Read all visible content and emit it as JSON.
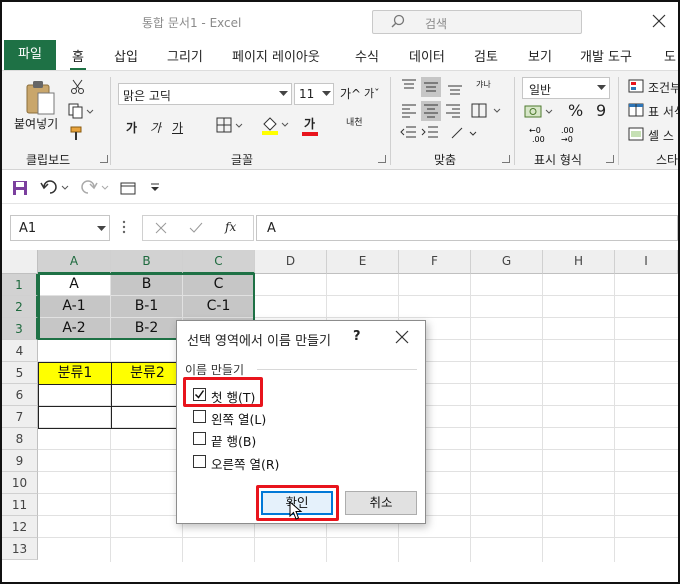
{
  "title_bar": {
    "doc_title": "통합 문서1  -  Excel",
    "search_placeholder": "검색"
  },
  "ribbon_tabs": [
    "파일",
    "홈",
    "삽입",
    "그리기",
    "페이지 레이아웃",
    "수식",
    "데이터",
    "검토",
    "보기",
    "개발 도구",
    "도"
  ],
  "ribbon": {
    "clipboard": {
      "paste_label": "붙여넣기",
      "group_label": "클립보드"
    },
    "font": {
      "font_name": "맑은 고딕",
      "font_size": "11",
      "grow": "가^",
      "shrink": "가ˇ",
      "bold": "가",
      "italic": "가",
      "underline": "가",
      "font_color_glyph": "가",
      "phonetic": "내천",
      "group_label": "글꼴"
    },
    "alignment": {
      "group_label": "맞춤",
      "wrap_glyph": "갸나"
    },
    "number": {
      "format": "일반",
      "percent": "%",
      "comma": "9",
      "group_label": "표시 형식"
    },
    "styles": {
      "conditional": "조건부",
      "table": "표 서식",
      "cell": "셀 스",
      "group_label": "스타"
    }
  },
  "formula_bar": {
    "name_box": "A1",
    "fx": "fx",
    "value": "A"
  },
  "columns": [
    "A",
    "B",
    "C",
    "D",
    "E",
    "F",
    "G",
    "H",
    "I"
  ],
  "rows": [
    "1",
    "2",
    "3",
    "4",
    "5",
    "6",
    "7",
    "8",
    "9",
    "10",
    "11",
    "12",
    "13"
  ],
  "cells": {
    "A1": "A",
    "B1": "B",
    "C1": "C",
    "A2": "A-1",
    "B2": "B-1",
    "C2": "C-1",
    "A3": "A-2",
    "B3": "B-2",
    "A5": "분류1",
    "B5": "분류2"
  },
  "dialog": {
    "title": "선택 영역에서 이름 만들기",
    "help": "?",
    "group_label": "이름 만들기",
    "options": [
      {
        "label": "첫 행(T)",
        "checked": true
      },
      {
        "label": "왼쪽 열(L)",
        "checked": false
      },
      {
        "label": "끝 행(B)",
        "checked": false
      },
      {
        "label": "오른쪽 열(R)",
        "checked": false
      }
    ],
    "ok": "확인",
    "cancel": "취소"
  },
  "colors": {
    "accent": "#1e7145",
    "highlight": "#e8141c",
    "yellow": "#ffff00",
    "shade": "#c6c6c6"
  }
}
